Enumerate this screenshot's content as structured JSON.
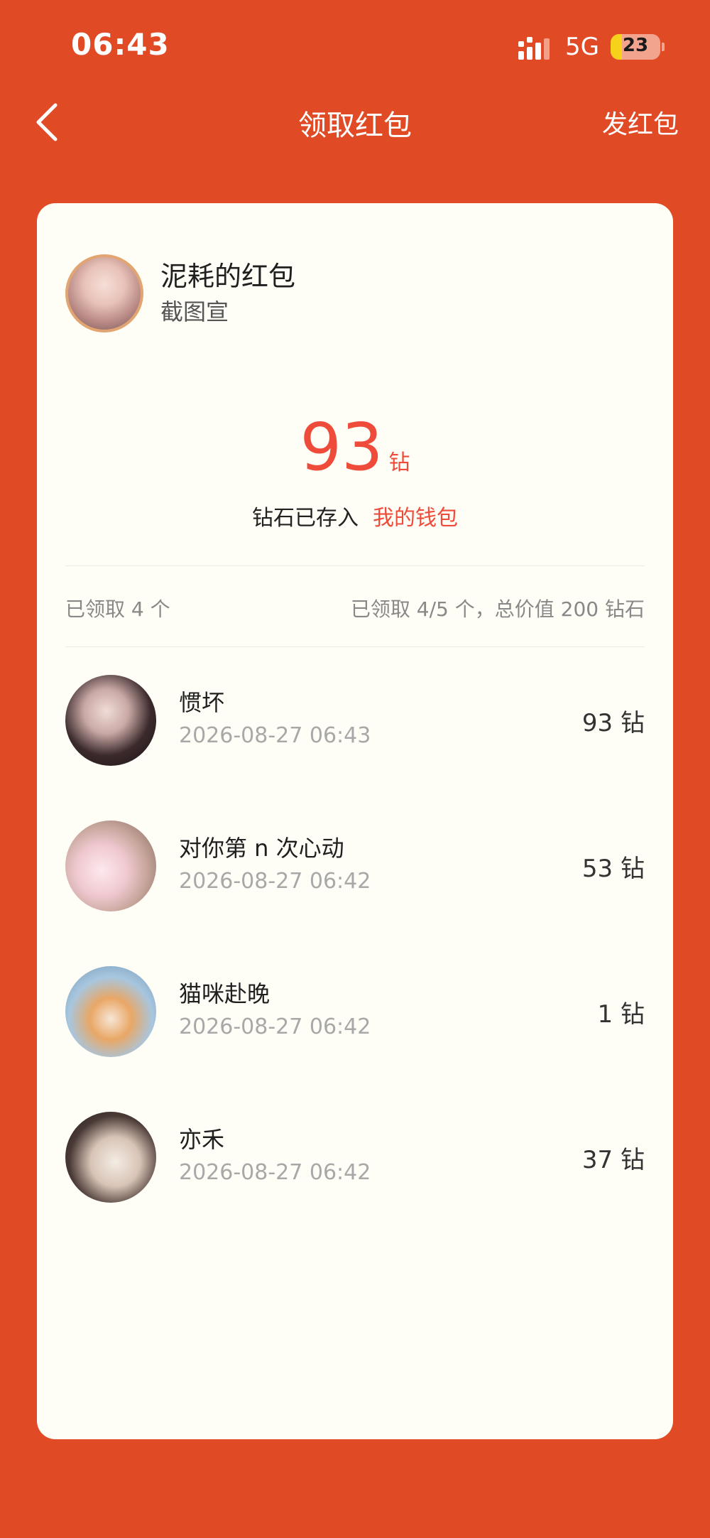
{
  "status_bar": {
    "time": "06:43",
    "network": "5G",
    "battery": "23",
    "battery_level": 0.23
  },
  "nav": {
    "title": "领取红包",
    "action": "发红包"
  },
  "packet": {
    "sender_name": "泥耗的红包",
    "note": "截图宣",
    "amount": "93",
    "unit": "钻",
    "wallet_text": "钻石已存入",
    "wallet_link": "我的钱包"
  },
  "summary": {
    "left": "已领取 4 个",
    "right": "已领取 4/5 个，总价值 200 钻石"
  },
  "recipients": [
    {
      "name": "惯坏",
      "time": "2026-08-27 06:43",
      "amount": "93 钻"
    },
    {
      "name": "对你第 n 次心动",
      "time": "2026-08-27 06:42",
      "amount": "53 钻"
    },
    {
      "name": "猫咪赴晚",
      "time": "2026-08-27 06:42",
      "amount": "1 钻"
    },
    {
      "name": "亦禾",
      "time": "2026-08-27 06:42",
      "amount": "37 钻"
    }
  ],
  "colors": {
    "background": "#E04B26",
    "card": "#FFFEF6",
    "accent": "#EF4B3B"
  }
}
